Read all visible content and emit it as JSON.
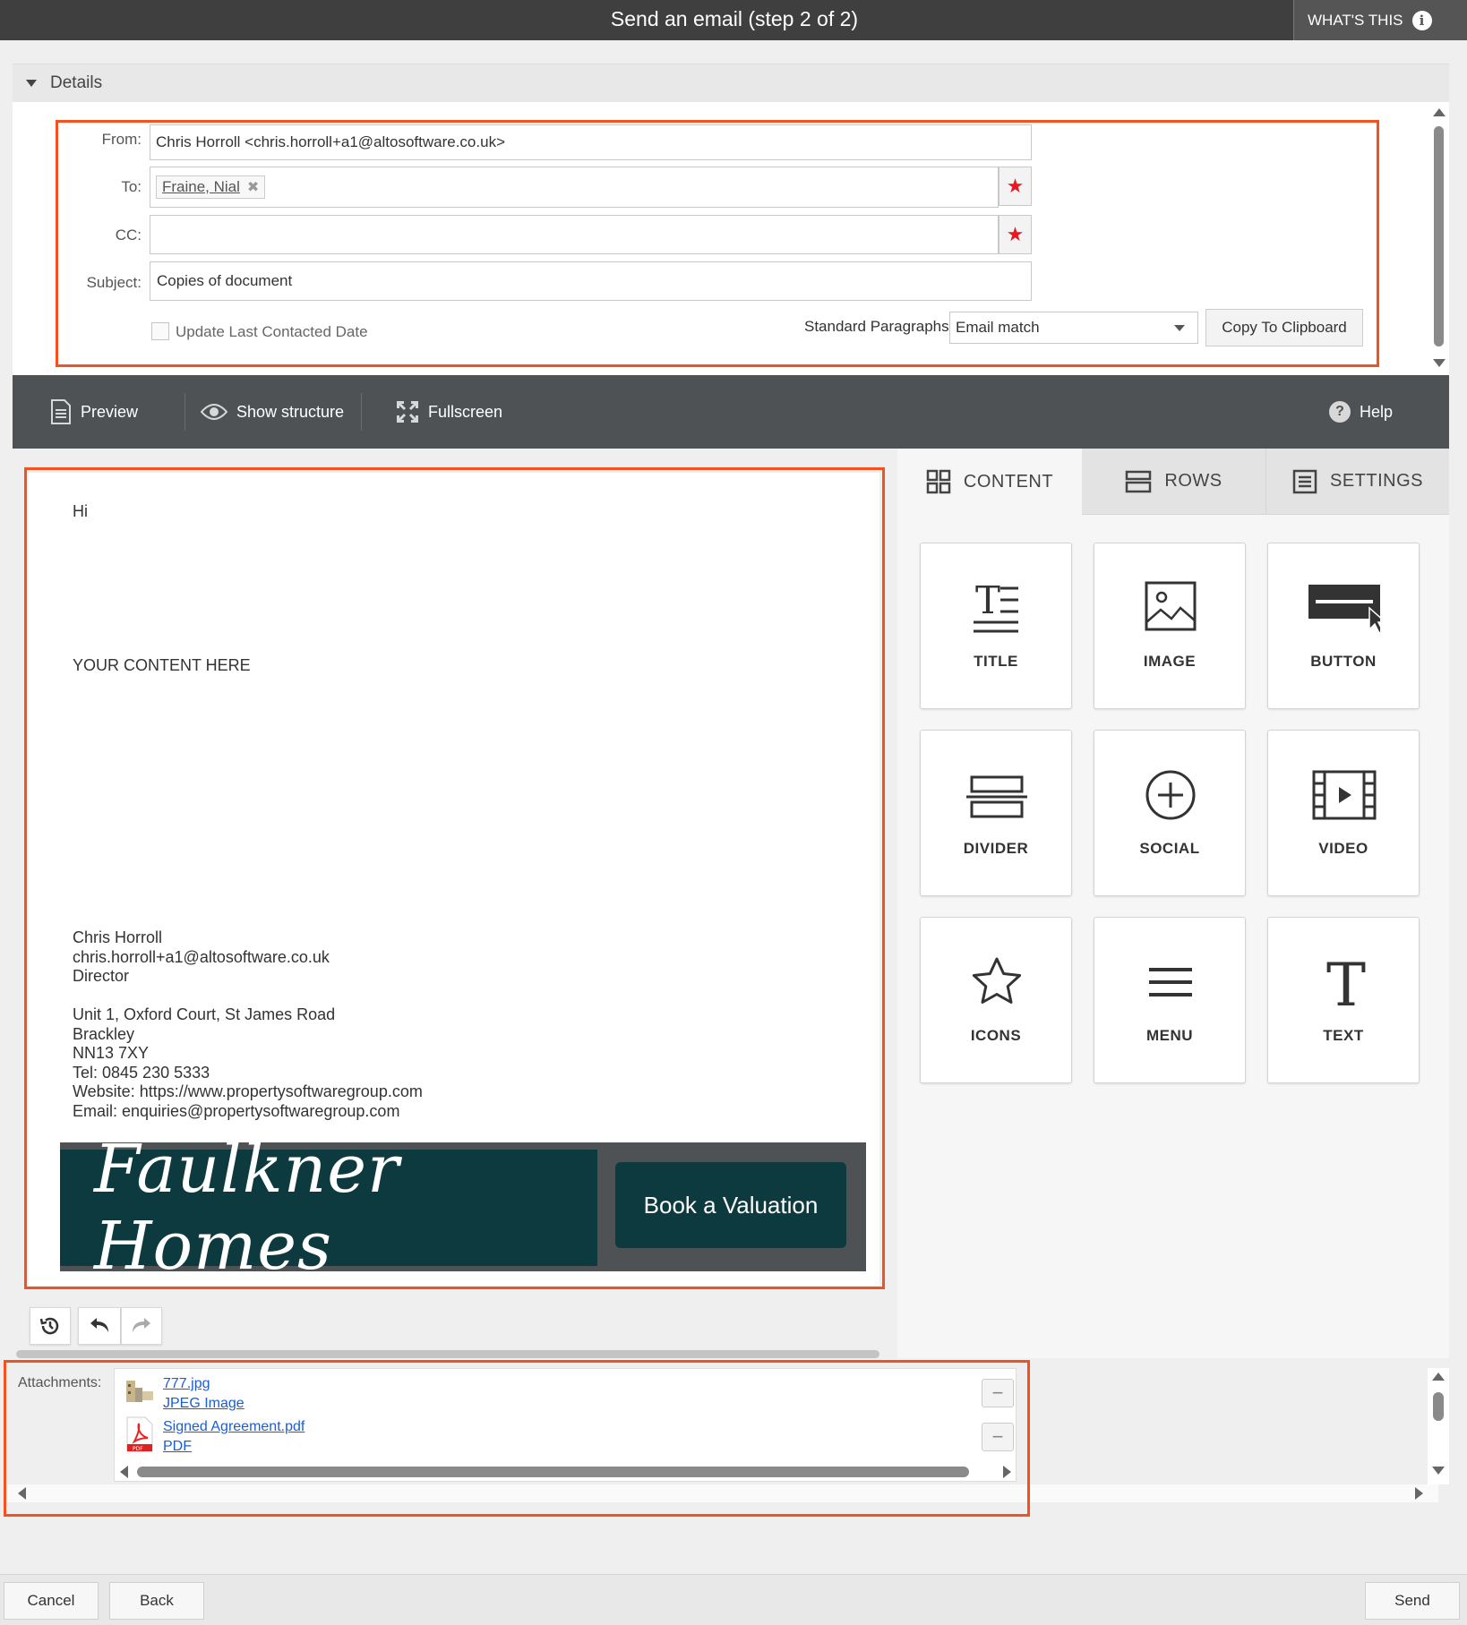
{
  "header": {
    "title": "Send an email (step 2 of 2)",
    "whats_this": "WHAT'S THIS",
    "info_icon": "i"
  },
  "details": {
    "section_label": "Details",
    "from_label": "From:",
    "from_value": "Chris Horroll <chris.horroll+a1@altosoftware.co.uk>",
    "to_label": "To:",
    "to_recipients": [
      "Fraine, Nial"
    ],
    "cc_label": "CC:",
    "cc_value": "",
    "subject_label": "Subject:",
    "subject_value": "Copies of document",
    "update_last_contacted_label": "Update Last Contacted Date",
    "update_last_contacted_checked": false,
    "standard_paragraphs_label": "Standard Paragraphs",
    "standard_paragraphs_value": "Email match",
    "copy_clipboard_label": "Copy To Clipboard",
    "required_icon": "★"
  },
  "toolbar": {
    "preview": "Preview",
    "show_structure": "Show structure",
    "fullscreen": "Fullscreen",
    "help": "Help"
  },
  "email": {
    "greeting": "Hi",
    "placeholder": "YOUR CONTENT HERE",
    "signature": {
      "name": "Chris Horroll",
      "email": "chris.horroll+a1@altosoftware.co.uk",
      "role": "Director",
      "address1": "Unit 1, Oxford Court, St James Road",
      "address2": "Brackley",
      "postcode": "NN13 7XY",
      "tel": "Tel: 0845 230 5333",
      "website_label": "Website: ",
      "website": "https://www.propertysoftwaregroup.com",
      "email_label": "Email: ",
      "enquiries": "enquiries@propertysoftwaregroup.com"
    },
    "banner": {
      "logo_text": "Faulkner Homes",
      "button": "Book a Valuation"
    }
  },
  "side": {
    "tabs": [
      {
        "label": "CONTENT",
        "icon": "grid-icon"
      },
      {
        "label": "ROWS",
        "icon": "rows-icon"
      },
      {
        "label": "SETTINGS",
        "icon": "settings-icon"
      }
    ],
    "active_tab": "CONTENT",
    "blocks": [
      "TITLE",
      "IMAGE",
      "BUTTON",
      "DIVIDER",
      "SOCIAL",
      "VIDEO",
      "ICONS",
      "MENU",
      "TEXT"
    ]
  },
  "attachments": {
    "label": "Attachments:",
    "items": [
      {
        "name": "777.jpg",
        "type": "JPEG Image",
        "icon": "image-file-icon"
      },
      {
        "name": "Signed Agreement.pdf",
        "type": "PDF",
        "icon": "pdf-file-icon"
      }
    ]
  },
  "footer": {
    "cancel": "Cancel",
    "back": "Back",
    "send": "Send"
  },
  "colors": {
    "highlight": "#f4511e",
    "header_bg": "#3f3f3f",
    "toolbar_bg": "#4f5254",
    "brand_teal": "#0d3a3f",
    "required": "#e41b23",
    "link": "#1a5dd6"
  }
}
